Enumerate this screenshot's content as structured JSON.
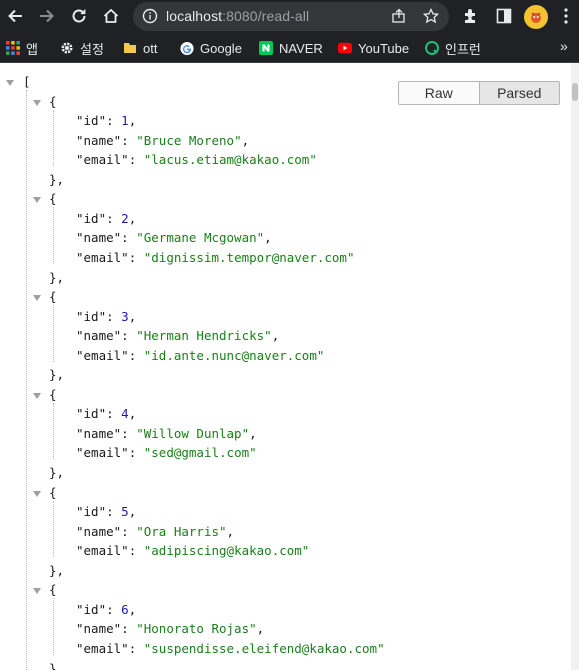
{
  "browser": {
    "url_host": "localhost",
    "url_rest": ":8080/read-all"
  },
  "bookmarks": [
    {
      "label": "앱",
      "icon": "apps-grid-icon"
    },
    {
      "label": "설정",
      "icon": "gear-icon"
    },
    {
      "label": "ott",
      "icon": "folder-icon"
    },
    {
      "label": "Google",
      "icon": "google-icon"
    },
    {
      "label": "NAVER",
      "icon": "naver-icon"
    },
    {
      "label": "YouTube",
      "icon": "youtube-icon"
    },
    {
      "label": "인프런",
      "icon": "inflearn-icon"
    }
  ],
  "viewer": {
    "raw_label": "Raw",
    "parsed_label": "Parsed",
    "active_mode": "Parsed"
  },
  "records": [
    {
      "id": "1",
      "name": "Bruce Moreno",
      "email": "lacus.etiam@kakao.com"
    },
    {
      "id": "2",
      "name": "Germane Mcgowan",
      "email": "dignissim.tempor@naver.com"
    },
    {
      "id": "3",
      "name": "Herman Hendricks",
      "email": "id.ante.nunc@naver.com"
    },
    {
      "id": "4",
      "name": "Willow Dunlap",
      "email": "sed@gmail.com"
    },
    {
      "id": "5",
      "name": "Ora Harris",
      "email": "adipiscing@kakao.com"
    },
    {
      "id": "6",
      "name": "Honorato Rojas",
      "email": "suspendisse.eleifend@kakao.com"
    }
  ]
}
